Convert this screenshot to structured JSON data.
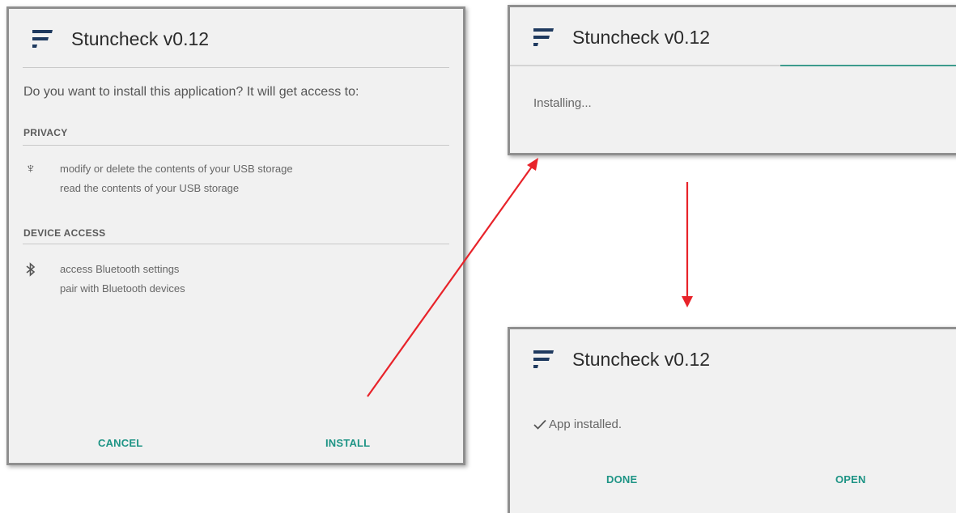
{
  "app_name": "Stuncheck v0.12",
  "install_dialog": {
    "prompt": "Do you want to install this application? It will get access to:",
    "sections": [
      {
        "heading": "PRIVACY",
        "icon": "usb-icon",
        "lines": [
          "modify or delete the contents of your USB storage",
          "read the contents of your USB storage"
        ]
      },
      {
        "heading": "DEVICE ACCESS",
        "icon": "bluetooth-icon",
        "lines": [
          "access Bluetooth settings",
          "pair with Bluetooth devices"
        ]
      }
    ],
    "cancel_label": "CANCEL",
    "install_label": "INSTALL"
  },
  "progress_dialog": {
    "status": "Installing...",
    "progress_percent": 40
  },
  "done_dialog": {
    "status": "App installed.",
    "done_label": "DONE",
    "open_label": "OPEN"
  },
  "colors": {
    "accent": "#1e9485",
    "progress": "#3d9c8d",
    "arrow": "#e8232a",
    "logo": "#1f3a5f"
  }
}
